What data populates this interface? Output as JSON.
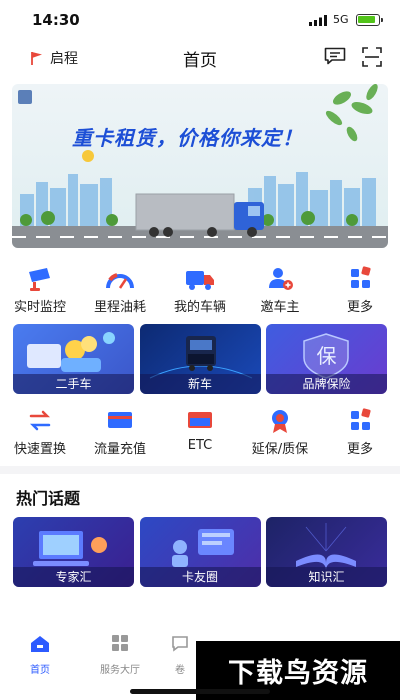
{
  "status": {
    "time": "14:30",
    "network": "5G"
  },
  "header": {
    "location": "启程",
    "title": "首页"
  },
  "banner": {
    "slogan": "重卡租赁，价格你来定！"
  },
  "services_row1": [
    {
      "label": "实时监控",
      "icon": "camera-icon"
    },
    {
      "label": "里程油耗",
      "icon": "speedometer-icon"
    },
    {
      "label": "我的车辆",
      "icon": "truck-icon"
    },
    {
      "label": "邀车主",
      "icon": "add-user-icon"
    },
    {
      "label": "更多",
      "icon": "grid-icon"
    }
  ],
  "cards_row": [
    {
      "label": "二手车"
    },
    {
      "label": "新车"
    },
    {
      "label": "品牌保险",
      "glyph": "保"
    }
  ],
  "services_row2": [
    {
      "label": "快速置换",
      "icon": "swap-icon"
    },
    {
      "label": "流量充值",
      "icon": "card-icon"
    },
    {
      "label": "ETC",
      "icon": "etc-card-icon"
    },
    {
      "label": "延保/质保",
      "icon": "badge-icon"
    },
    {
      "label": "更多",
      "icon": "grid-icon"
    }
  ],
  "hot_topics": {
    "title": "热门话题",
    "items": [
      {
        "label": "专家汇"
      },
      {
        "label": "卡友圈"
      },
      {
        "label": "知识汇"
      }
    ]
  },
  "tabbar": [
    {
      "label": "首页",
      "icon": "home-icon"
    },
    {
      "label": "服务大厅",
      "icon": "apps-icon"
    },
    {
      "label": "卷",
      "icon": "chat-icon"
    }
  ],
  "watermark": "下载鸟资源",
  "colors": {
    "accent": "#2d5bff",
    "icon_blue": "#2f6bff",
    "icon_red": "#e8483b"
  }
}
